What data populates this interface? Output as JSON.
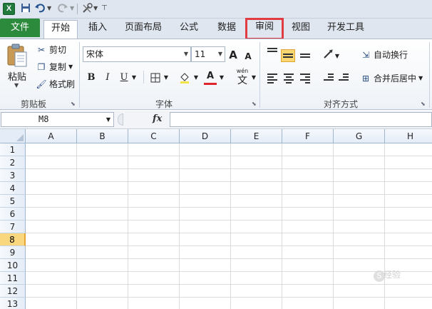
{
  "qat": {
    "app_letter": "X",
    "save_icon": "save-icon",
    "undo_icon": "undo-icon",
    "redo_icon": "redo-icon",
    "tools_icon": "tools-icon"
  },
  "tabs": {
    "file": "文件",
    "items": [
      "开始",
      "插入",
      "页面布局",
      "公式",
      "数据",
      "审阅",
      "视图",
      "开发工具"
    ],
    "active": "开始",
    "highlighted": "审阅",
    "highlight_color": "#e23c43",
    "file_color": "#2c8a3c"
  },
  "clipboard": {
    "paste": "粘贴",
    "cut": "剪切",
    "copy": "复制",
    "format_painter": "格式刷",
    "group_label": "剪贴板"
  },
  "font": {
    "name": "宋体",
    "size": "11",
    "grow": "A",
    "shrink": "A",
    "bold": "B",
    "italic": "I",
    "underline": "U",
    "font_color_letter": "A",
    "wen": "wén",
    "wen_char": "文",
    "group_label": "字体",
    "font_color": "#e0262c"
  },
  "alignment": {
    "wrap_text": "自动换行",
    "merge_center": "合并后居中",
    "group_label": "对齐方式"
  },
  "formula_bar": {
    "name_box": "M8",
    "fx": "fx",
    "value": ""
  },
  "sheet": {
    "columns": [
      "A",
      "B",
      "C",
      "D",
      "E",
      "F",
      "G",
      "H"
    ],
    "rows": [
      "1",
      "2",
      "3",
      "4",
      "5",
      "6",
      "7",
      "8",
      "9",
      "10",
      "11",
      "12",
      "13"
    ],
    "selected_row": "8",
    "selected_color": "#f9d77e"
  },
  "watermark": {
    "text": "经验"
  }
}
